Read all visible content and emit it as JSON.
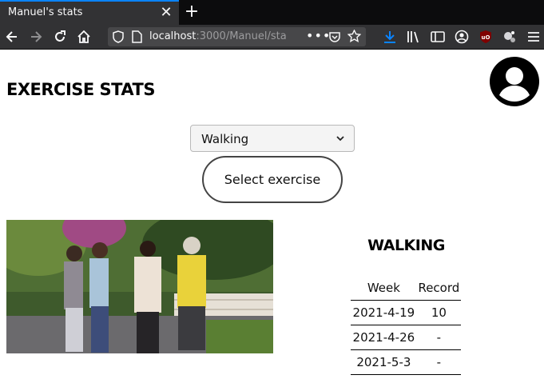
{
  "browser": {
    "tab_title": "Manuel's stats",
    "tab_close": "✕",
    "new_tab": "+",
    "url_host": "localhost",
    "url_rest": ":3000/Manuel/sta",
    "url_dots": "•••",
    "accent": "#0a84ff"
  },
  "page": {
    "title": "EXERCISE STATS",
    "exercise_select": {
      "selected": "Walking"
    },
    "select_button": "Select exercise",
    "exercise_heading": "WALKING",
    "table": {
      "headers": [
        "Week",
        "Record"
      ],
      "rows": [
        [
          "2021-4-19",
          "10"
        ],
        [
          "2021-4-26",
          "-"
        ],
        [
          "2021-5-3",
          "-"
        ]
      ]
    }
  }
}
